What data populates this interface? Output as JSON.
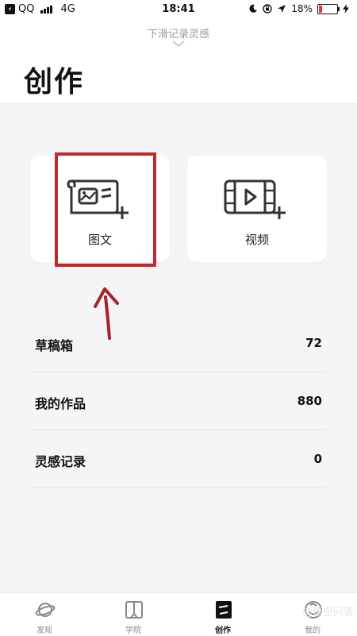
{
  "status_bar": {
    "carrier": "QQ",
    "network": "4G",
    "time": "18:41",
    "battery": "18%",
    "battery_level": 0.18
  },
  "header": {
    "pull_hint": "下滑记录灵感",
    "title": "创作"
  },
  "cards": [
    {
      "label": "图文",
      "icon": "image-text-add-icon"
    },
    {
      "label": "视频",
      "icon": "video-add-icon"
    }
  ],
  "list": [
    {
      "label": "草稿箱",
      "count": "72"
    },
    {
      "label": "我的作品",
      "count": "880"
    },
    {
      "label": "灵感记录",
      "count": "0"
    }
  ],
  "tabbar": {
    "tabs": [
      {
        "label": "发现",
        "icon": "planet-icon"
      },
      {
        "label": "学院",
        "icon": "book-icon"
      },
      {
        "label": "创作",
        "icon": "create-icon",
        "active": true
      },
      {
        "label": "我的",
        "icon": "profile-icon"
      }
    ]
  },
  "watermark": "@悟空问答",
  "colors": {
    "highlight": "#c0282c",
    "background": "#f5f5f7"
  }
}
